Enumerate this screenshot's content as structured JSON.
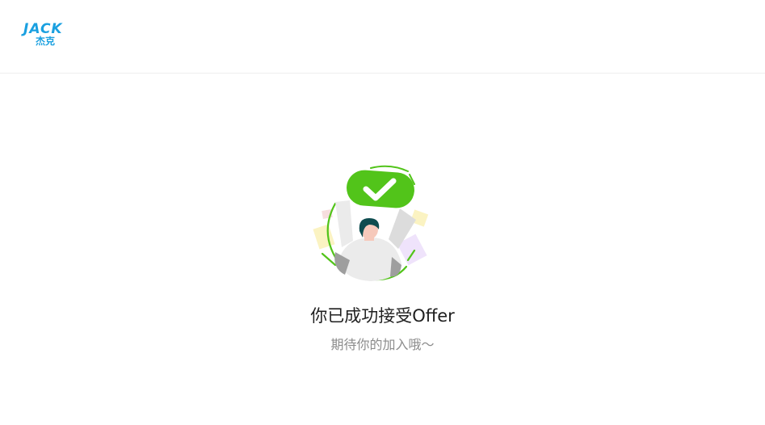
{
  "header": {
    "logo_en": "JACK",
    "logo_cn": "杰克"
  },
  "main": {
    "title": "你已成功接受Offer",
    "subtitle": "期待你的加入哦～"
  },
  "colors": {
    "brand": "#1aa0e0",
    "success": "#52c41a"
  },
  "icons": {
    "illustration": "offer-accepted-checkmark-person-illustration"
  }
}
